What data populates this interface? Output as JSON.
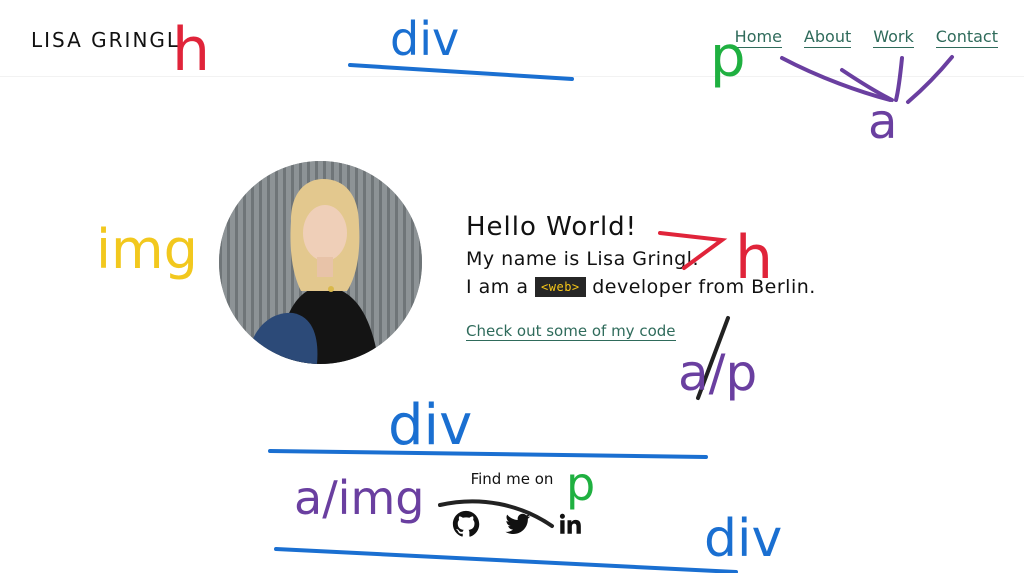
{
  "header": {
    "brand": "LISA GRINGL",
    "nav": [
      {
        "label": "Home"
      },
      {
        "label": "About"
      },
      {
        "label": "Work"
      },
      {
        "label": "Contact"
      }
    ]
  },
  "hero": {
    "hello": "Hello World!",
    "name_line": "My name is Lisa Gringl.",
    "role_prefix": "I am a",
    "role_tag": "<web>",
    "role_suffix": "developer from Berlin.",
    "code_link": "Check out some of my code"
  },
  "footer": {
    "find_label": "Find me on",
    "socials": [
      {
        "icon": "github-icon"
      },
      {
        "icon": "twitter-icon"
      },
      {
        "icon": "linkedin-icon"
      }
    ]
  },
  "annotations": {
    "labels": [
      "h",
      "div",
      "p",
      "a",
      "img",
      "h",
      "a/p",
      "div",
      "a/img",
      "p",
      "div"
    ],
    "colors": {
      "h": "#e0243a",
      "div": "#1a6fd1",
      "p": "#1fb040",
      "a": "#6a3fa0",
      "img": "#f2c81e"
    }
  },
  "colors": {
    "link": "#2f6b5b",
    "tag_bg": "#262626",
    "tag_fg": "#f5c518"
  }
}
